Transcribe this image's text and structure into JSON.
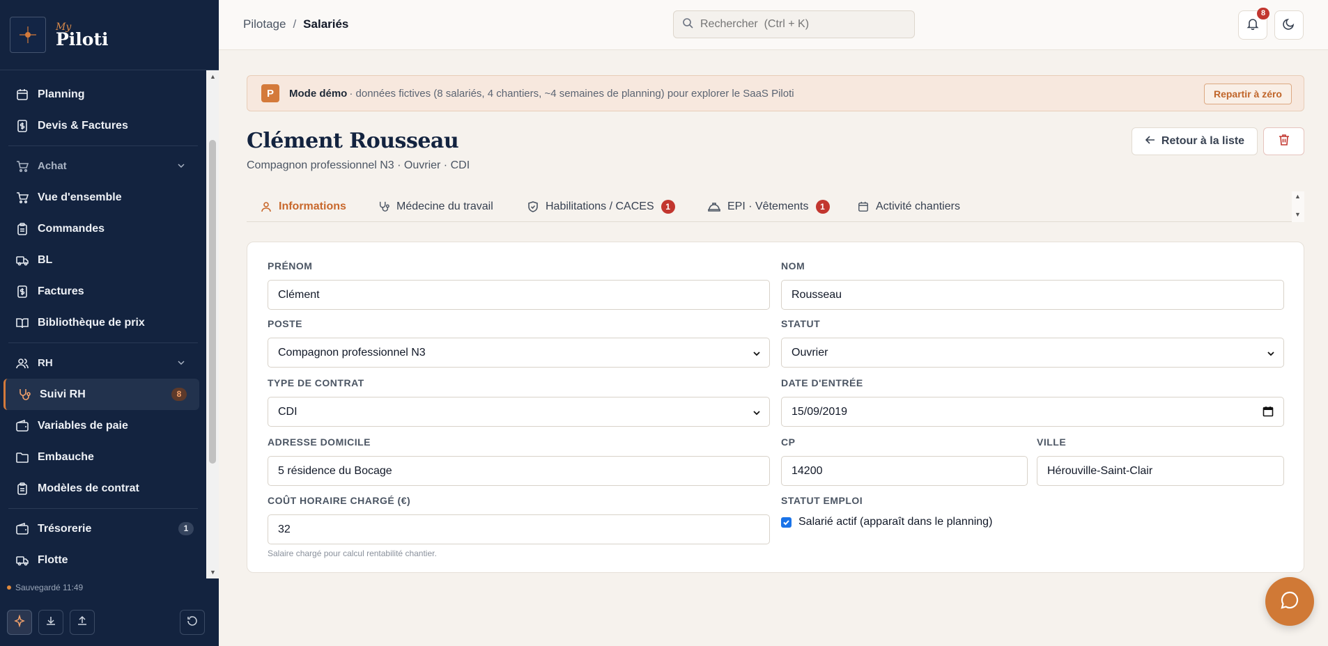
{
  "brand": {
    "prefix": "My",
    "name": "Piloti"
  },
  "sidebar": {
    "items": [
      {
        "label": "Planning",
        "icon": "calendar-icon"
      },
      {
        "label": "Devis & Factures",
        "icon": "dollar-doc-icon"
      },
      {
        "label": "Achat",
        "icon": "cart-icon",
        "section": true
      },
      {
        "label": "Vue d'ensemble",
        "icon": "cart-icon"
      },
      {
        "label": "Commandes",
        "icon": "clipboard-icon"
      },
      {
        "label": "BL",
        "icon": "truck-icon"
      },
      {
        "label": "Factures",
        "icon": "dollar-doc-icon"
      },
      {
        "label": "Bibliothèque de prix",
        "icon": "book-icon"
      },
      {
        "label": "RH",
        "icon": "users-icon",
        "section": true
      },
      {
        "label": "Suivi RH",
        "icon": "stethoscope-icon",
        "count": "8",
        "active": true
      },
      {
        "label": "Variables de paie",
        "icon": "wallet-icon"
      },
      {
        "label": "Embauche",
        "icon": "folder-icon"
      },
      {
        "label": "Modèles de contrat",
        "icon": "clipboard-icon"
      },
      {
        "label": "Trésorerie",
        "icon": "wallet-icon",
        "count": "1"
      },
      {
        "label": "Flotte",
        "icon": "truck-icon"
      }
    ],
    "saved_status": "Sauvegardé 11:49"
  },
  "topbar": {
    "breadcrumb_root": "Pilotage",
    "breadcrumb_sep": "/",
    "breadcrumb_current": "Salariés",
    "search_placeholder": "Rechercher  (Ctrl + K)",
    "notif_count": "8"
  },
  "demo": {
    "badge": "P",
    "title": "Mode démo",
    "desc": "· données fictives (8 salariés, 4 chantiers, ~4 semaines de planning) pour explorer le SaaS Piloti",
    "reset_label": "Repartir à zéro"
  },
  "employee": {
    "name": "Clément Rousseau",
    "subtitle": "Compagnon professionnel N3 · Ouvrier · CDI",
    "back_label": "Retour à la liste"
  },
  "tabs": [
    {
      "label": "Informations",
      "icon": "user-icon",
      "active": true
    },
    {
      "label": "Médecine du travail",
      "icon": "stethoscope-icon"
    },
    {
      "label": "Habilitations / CACES",
      "icon": "shield-icon",
      "badge": "1"
    },
    {
      "label": "EPI · Vêtements",
      "icon": "helmet-icon",
      "badge": "1"
    },
    {
      "label": "Activité chantiers",
      "icon": "calendar-icon"
    }
  ],
  "form": {
    "prenom_label": "PRÉNOM",
    "prenom_value": "Clément",
    "nom_label": "NOM",
    "nom_value": "Rousseau",
    "poste_label": "POSTE",
    "poste_value": "Compagnon professionnel N3",
    "statut_label": "STATUT",
    "statut_value": "Ouvrier",
    "contrat_label": "TYPE DE CONTRAT",
    "contrat_value": "CDI",
    "entree_label": "DATE D'ENTRÉE",
    "entree_value": "15/09/2019",
    "adresse_label": "ADRESSE DOMICILE",
    "adresse_value": "5 résidence du Bocage",
    "cp_label": "CP",
    "cp_value": "14200",
    "ville_label": "VILLE",
    "ville_value": "Hérouville-Saint-Clair",
    "cout_label": "COÛT HORAIRE CHARGÉ (€)",
    "cout_value": "32",
    "cout_hint": "Salaire chargé pour calcul rentabilité chantier.",
    "emploi_label": "STATUT EMPLOI",
    "actif_label": "Salarié actif (apparaît dans le planning)",
    "actif_checked": true
  },
  "colors": {
    "sidebar": "#13233f",
    "accent": "#d47a3b",
    "badge": "#c2362f",
    "page": "#f6f2ed"
  }
}
